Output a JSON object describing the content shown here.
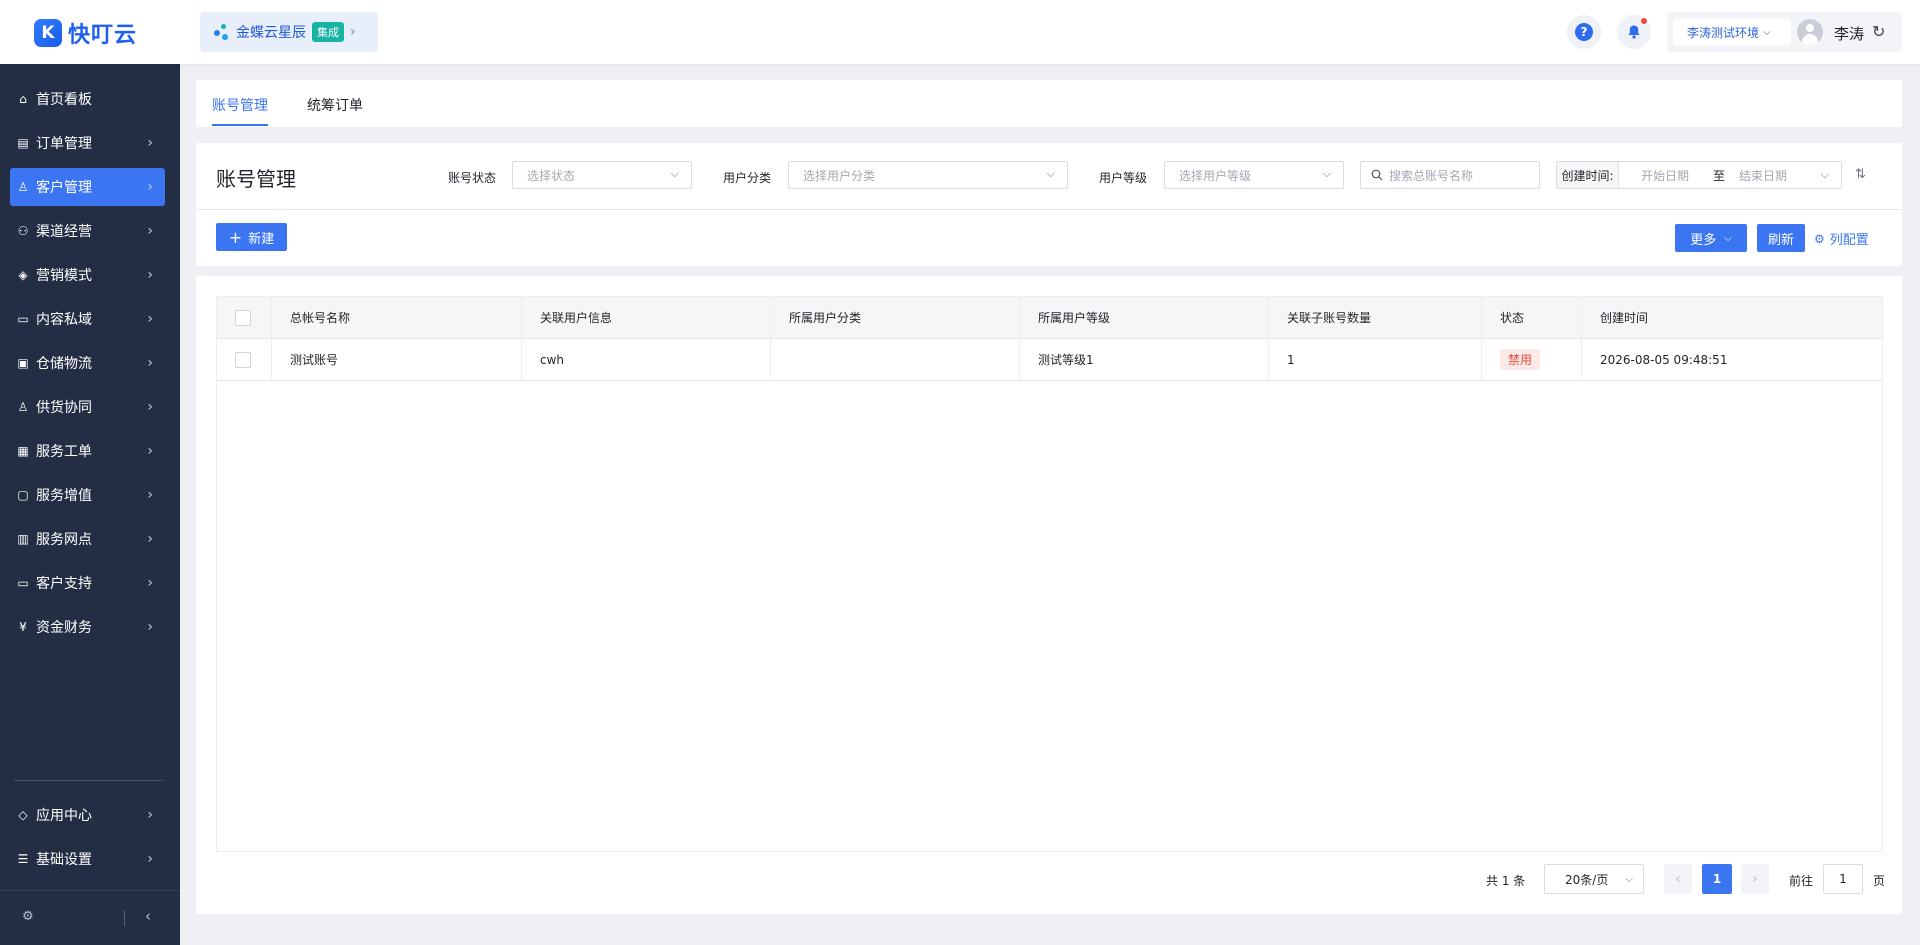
{
  "header": {
    "logo_mark": "K",
    "logo_text": "快叮云",
    "integration_name": "金蝶云星辰",
    "integration_badge": "集成",
    "help_glyph": "?",
    "environment": "李涛测试环境",
    "user_name": "李涛"
  },
  "sidebar": {
    "items": [
      {
        "label": "首页看板",
        "icon": "home-icon",
        "glyph": "⌂"
      },
      {
        "label": "订单管理",
        "icon": "order-icon",
        "glyph": "▤"
      },
      {
        "label": "客户管理",
        "icon": "customer-icon",
        "glyph": "♙"
      },
      {
        "label": "渠道经营",
        "icon": "channel-icon",
        "glyph": "⚇"
      },
      {
        "label": "营销模式",
        "icon": "tag-icon",
        "glyph": "◈"
      },
      {
        "label": "内容私域",
        "icon": "image-icon",
        "glyph": "▭"
      },
      {
        "label": "仓储物流",
        "icon": "warehouse-icon",
        "glyph": "▣"
      },
      {
        "label": "供货协同",
        "icon": "supply-icon",
        "glyph": "♙"
      },
      {
        "label": "服务工单",
        "icon": "ticket-icon",
        "glyph": "▦"
      },
      {
        "label": "服务增值",
        "icon": "bag-icon",
        "glyph": "▢"
      },
      {
        "label": "服务网点",
        "icon": "store-icon",
        "glyph": "▥"
      },
      {
        "label": "客户支持",
        "icon": "support-icon",
        "glyph": "▭"
      },
      {
        "label": "资金财务",
        "icon": "finance-icon",
        "glyph": "¥"
      }
    ],
    "bottom_items": [
      {
        "label": "应用中心",
        "icon": "cube-icon",
        "glyph": "◇"
      },
      {
        "label": "基础设置",
        "icon": "settings-list-icon",
        "glyph": "☰"
      }
    ],
    "active_index": 2
  },
  "tabs": [
    {
      "label": "账号管理",
      "active": true
    },
    {
      "label": "统筹订单",
      "active": false
    }
  ],
  "filters": {
    "page_title": "账号管理",
    "account_status_label": "账号状态",
    "account_status_placeholder": "选择状态",
    "user_category_label": "用户分类",
    "user_category_placeholder": "选择用户分类",
    "user_level_label": "用户等级",
    "user_level_placeholder": "选择用户等级",
    "search_placeholder": "搜索总账号名称",
    "created_time_label": "创建时间:",
    "start_date_placeholder": "开始日期",
    "date_separator": "至",
    "end_date_placeholder": "结束日期"
  },
  "toolbar": {
    "new_label": "新建",
    "more_label": "更多",
    "refresh_label": "刷新",
    "column_config_label": "列配置"
  },
  "table": {
    "columns": [
      "总帐号名称",
      "关联用户信息",
      "所属用户分类",
      "所属用户等级",
      "关联子账号数量",
      "状态",
      "创建时间"
    ],
    "rows": [
      {
        "name": "测试账号",
        "user_info": "cwh",
        "category": "",
        "level": "测试等级1",
        "sub_count": "1",
        "status": "禁用",
        "created": "2026-08-05 09:48:51"
      }
    ]
  },
  "pagination": {
    "total_text": "共 1 条",
    "page_size": "20条/页",
    "current_page": "1",
    "goto_label": "前往",
    "goto_value": "1",
    "page_suffix": "页"
  },
  "colors": {
    "primary": "#3b75f2",
    "sidebar_bg": "#232e44",
    "danger": "#e04b3a"
  }
}
